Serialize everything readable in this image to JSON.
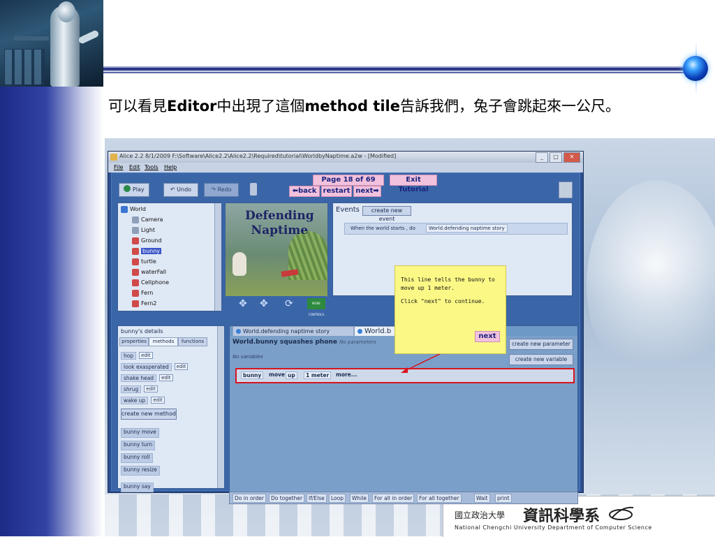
{
  "slide": {
    "caption_parts": [
      "可以看見",
      "Editor",
      "中出現了這個",
      "method tile",
      "告訴我們，兔子會跳起來一公尺。"
    ],
    "logo": {
      "small": "國立政治大學",
      "big": "資訊科學系",
      "english": "National Chengchi University Department of Computer Science"
    }
  },
  "window": {
    "title": "Alice 2.2 8/1/2009 F:\\Software\\Alice2.2\\Alice2.2\\Required\\tutorial\\WorldbyNaptime.a2w - [Modified]",
    "controls": [
      "_",
      "□",
      "✕"
    ],
    "menu": [
      "File",
      "Edit",
      "Tools",
      "Help"
    ]
  },
  "toolbar": {
    "play": "Play",
    "undo": "Undo",
    "redo": "Redo",
    "page": "Page 18 of 69",
    "exit": "Exit Tutorial",
    "back": "back",
    "restart": "restart",
    "next": "next"
  },
  "tree": {
    "items": [
      {
        "label": "World",
        "icon": "world-icon"
      },
      {
        "label": "Camera",
        "icon": "camera-icon"
      },
      {
        "label": "Light",
        "icon": "light-icon"
      },
      {
        "label": "Ground",
        "icon": "object-icon"
      },
      {
        "label": "bunny",
        "icon": "object-icon",
        "selected": true
      },
      {
        "label": "turtle",
        "icon": "object-icon"
      },
      {
        "label": "waterFall",
        "icon": "object-icon"
      },
      {
        "label": "Cellphone",
        "icon": "object-icon"
      },
      {
        "label": "Fern",
        "icon": "object-icon"
      },
      {
        "label": "Fern2",
        "icon": "object-icon"
      }
    ]
  },
  "scene": {
    "title_line1": "Defending",
    "title_line2": "Naptime",
    "badge": "MORE CONTROLS"
  },
  "events": {
    "label": "Events",
    "create": "create new event",
    "when": "When the world starts , do",
    "handler": "World.defending naptime story"
  },
  "tooltip": {
    "line1": "This line tells the bunny to move up 1 meter.",
    "line2": "Click \"next\" to continue.",
    "next": "next"
  },
  "details": {
    "header": "bunny's details",
    "tabs": [
      "properties",
      "methods",
      "functions"
    ],
    "methods": [
      {
        "name": "hop",
        "edit": "edit"
      },
      {
        "name": "look exasperated",
        "edit": "edit"
      },
      {
        "name": "shake head",
        "edit": "edit"
      },
      {
        "name": "shrug",
        "edit": "edit"
      },
      {
        "name": "wake up",
        "edit": "edit"
      }
    ],
    "create_method": "create new method",
    "tiles": [
      "bunny  move",
      "bunny  turn",
      "bunny  roll",
      "bunny  resize",
      "bunny  say"
    ]
  },
  "editor": {
    "tabs": [
      "World.defending naptime story",
      "World.b"
    ],
    "method_title": "World.bunny squashes phone",
    "no_params": "No parameters",
    "no_vars": "No variables",
    "create_param": "create new parameter",
    "create_var": "create new variable",
    "statement": {
      "object": "bunny",
      "verb": "move",
      "direction": "up",
      "amount": "1 meter",
      "more": "more..."
    },
    "controls": [
      "Do in order",
      "Do together",
      "If/Else",
      "Loop",
      "While",
      "For all in order",
      "For all together",
      "Wait",
      "print"
    ]
  },
  "colors": {
    "accent_red": "#d9141e",
    "tooltip_yellow": "#fbf886",
    "nav_pink": "#f2c2dd"
  }
}
